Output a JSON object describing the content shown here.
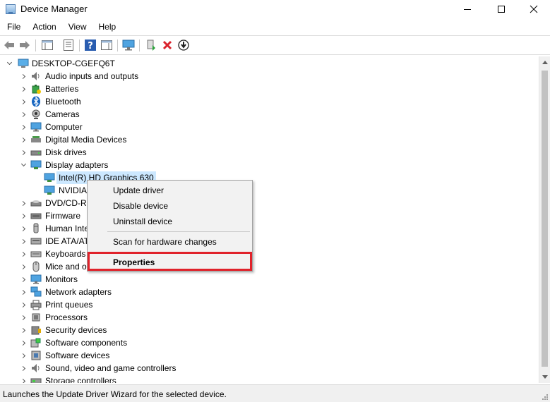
{
  "window": {
    "title": "Device Manager"
  },
  "menu": [
    "File",
    "Action",
    "View",
    "Help"
  ],
  "tree": {
    "root": "DESKTOP-CGEFQ6T",
    "items": [
      {
        "label": "Audio inputs and outputs",
        "icon": "speaker-icon"
      },
      {
        "label": "Batteries",
        "icon": "battery-icon"
      },
      {
        "label": "Bluetooth",
        "icon": "bluetooth-icon"
      },
      {
        "label": "Cameras",
        "icon": "camera-icon"
      },
      {
        "label": "Computer",
        "icon": "monitor-icon"
      },
      {
        "label": "Digital Media Devices",
        "icon": "media-device-icon"
      },
      {
        "label": "Disk drives",
        "icon": "disk-drive-icon"
      },
      {
        "label": "Display adapters",
        "icon": "display-adapter-icon",
        "expanded": true
      },
      {
        "label": "DVD/CD-RC",
        "icon": "dvd-icon"
      },
      {
        "label": "Firmware",
        "icon": "firmware-icon"
      },
      {
        "label": "Human Inte",
        "icon": "hid-icon"
      },
      {
        "label": "IDE ATA/ATA",
        "icon": "ide-icon"
      },
      {
        "label": "Keyboards",
        "icon": "keyboard-icon"
      },
      {
        "label": "Mice and o",
        "icon": "mouse-icon"
      },
      {
        "label": "Monitors",
        "icon": "monitor-icon"
      },
      {
        "label": "Network adapters",
        "icon": "network-icon"
      },
      {
        "label": "Print queues",
        "icon": "printer-icon"
      },
      {
        "label": "Processors",
        "icon": "processor-icon"
      },
      {
        "label": "Security devices",
        "icon": "security-icon"
      },
      {
        "label": "Software components",
        "icon": "software-component-icon"
      },
      {
        "label": "Software devices",
        "icon": "software-device-icon"
      },
      {
        "label": "Sound, video and game controllers",
        "icon": "speaker-icon"
      },
      {
        "label": "Storage controllers",
        "icon": "storage-icon"
      }
    ],
    "display_children": [
      {
        "label": "Intel(R) HD Graphics 630",
        "selected": true
      },
      {
        "label": "NVIDIA"
      }
    ]
  },
  "context_menu": {
    "items": [
      "Update driver",
      "Disable device",
      "Uninstall device"
    ],
    "scan": "Scan for hardware changes",
    "properties": "Properties"
  },
  "status": {
    "text": "Launches the Update Driver Wizard for the selected device."
  },
  "colors": {
    "selection": "#cce8ff",
    "highlight_box": "#e0222b",
    "menu_bg": "#f2f2f2"
  }
}
